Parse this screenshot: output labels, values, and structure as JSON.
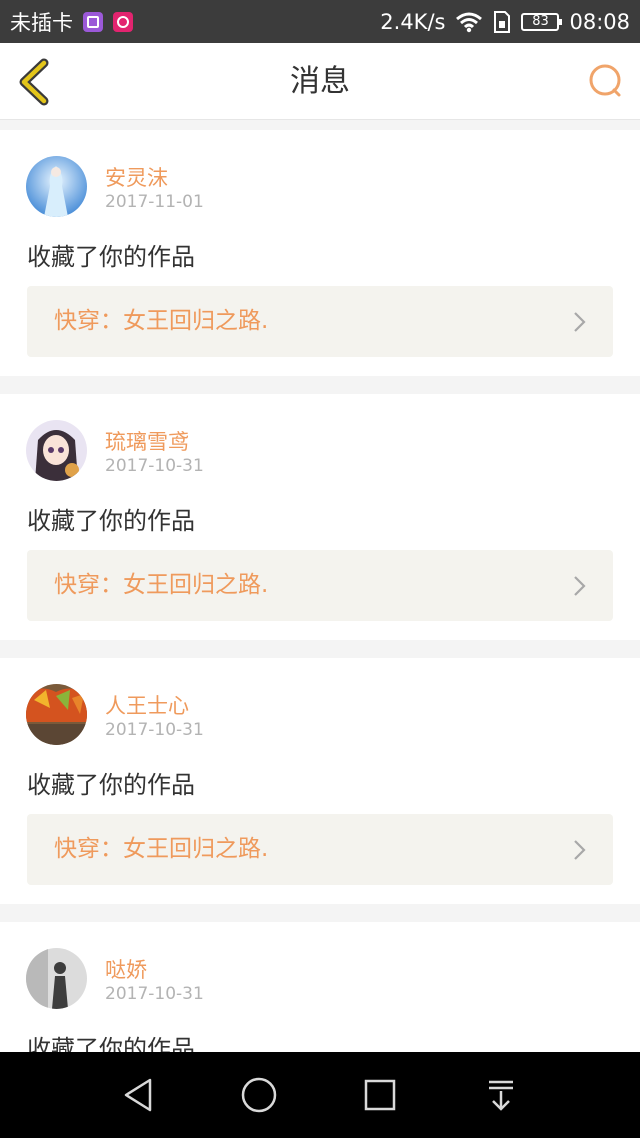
{
  "status_bar": {
    "carrier": "未插卡",
    "speed": "2.4K/s",
    "battery": "83",
    "time": "08:08",
    "icons": [
      "gallery-icon",
      "camera-icon",
      "wifi-icon",
      "sim-icon",
      "battery-icon"
    ]
  },
  "header": {
    "title": "消息",
    "back_icon": "chevron-left-icon",
    "search_icon": "search-icon"
  },
  "colors": {
    "accent": "#ef9a5c",
    "back_icon": "#d4b400",
    "text": "#333333",
    "date": "#b3b3b3",
    "link_bg": "#f4f3ee"
  },
  "messages": [
    {
      "name": "安灵沫",
      "date": "2017-11-01",
      "action": "收藏了你的作品",
      "work": "快穿：女王回归之路.",
      "avatar": "avatar-ice-princess"
    },
    {
      "name": "琉璃雪鸢",
      "date": "2017-10-31",
      "action": "收藏了你的作品",
      "work": "快穿：女王回归之路.",
      "avatar": "avatar-anime-girl"
    },
    {
      "name": "人王士心",
      "date": "2017-10-31",
      "action": "收藏了你的作品",
      "work": "快穿：女王回归之路.",
      "avatar": "avatar-autumn-leaves"
    },
    {
      "name": "哒娇",
      "date": "2017-10-31",
      "action": "收藏了你的作品",
      "avatar": "avatar-silhouette"
    }
  ],
  "nav_bar": {
    "icons": [
      "back-triangle-icon",
      "home-circle-icon",
      "recents-square-icon",
      "notification-pull-icon"
    ]
  }
}
